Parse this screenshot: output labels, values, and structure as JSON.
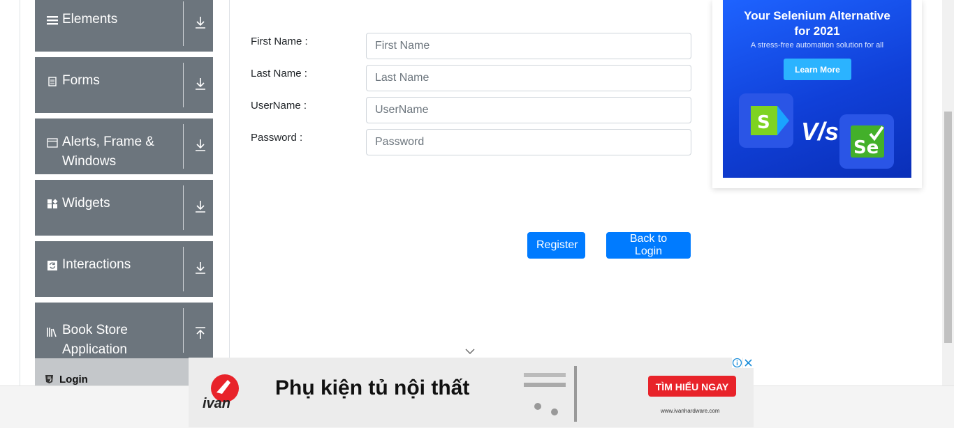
{
  "sidebar": {
    "groups": [
      {
        "label": "Elements",
        "icon": "hamburger-icon",
        "arrow": "download-arrow-icon"
      },
      {
        "label": "Forms",
        "icon": "document-icon",
        "arrow": "download-arrow-icon"
      },
      {
        "label": "Alerts, Frame & Windows",
        "icon": "window-icon",
        "arrow": "download-arrow-icon"
      },
      {
        "label": "Widgets",
        "icon": "widgets-icon",
        "arrow": "download-arrow-icon"
      },
      {
        "label": "Interactions",
        "icon": "refresh-icon",
        "arrow": "download-arrow-icon"
      },
      {
        "label": "Book Store Application",
        "icon": "books-icon",
        "arrow": "upload-arrow-icon"
      }
    ],
    "active_item": {
      "label": "Login",
      "icon": "html5-icon"
    }
  },
  "form": {
    "first_name": {
      "label": "First Name :",
      "placeholder": "First Name",
      "value": ""
    },
    "last_name": {
      "label": "Last Name :",
      "placeholder": "Last Name",
      "value": ""
    },
    "username": {
      "label": "UserName :",
      "placeholder": "UserName",
      "value": ""
    },
    "password": {
      "label": "Password :",
      "placeholder": "Password",
      "value": ""
    },
    "register_label": "Register",
    "back_label": "Back to Login"
  },
  "side_ad": {
    "title_line1": "Your Selenium Alternative",
    "title_line2": "for 2021",
    "subtitle": "A stress-free automation solution for all",
    "cta": "Learn More",
    "vs": "V/s"
  },
  "bottom_ad": {
    "brand": "ivan",
    "headline": "Phụ kiện tủ nội thất",
    "cta": "TÌM HIỂU NGAY",
    "url": "www.ivanhardware.com"
  },
  "colors": {
    "sidebar_bg": "#6c757d",
    "active_item_bg": "#c4c7ca",
    "primary": "#007bff",
    "ad_blue": "#1e63ff",
    "ad_cta_red": "#e8232a"
  }
}
